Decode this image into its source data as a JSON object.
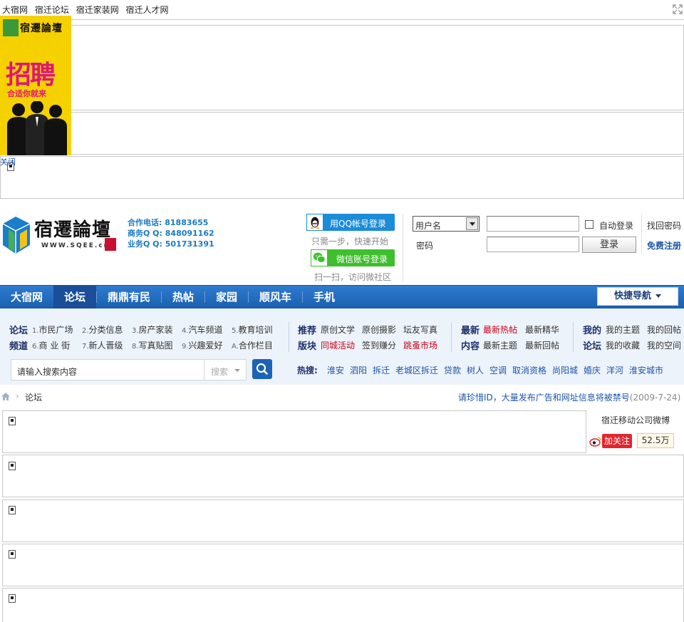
{
  "top_links": [
    "大宿网",
    "宿迁论坛",
    "宿迁家装网",
    "宿迁人才网"
  ],
  "ad": {
    "logo_text": "宿遷論壇",
    "headline": "招聘",
    "slogan": "合适你就来",
    "close_label": "关闭"
  },
  "header": {
    "logo_text": "宿遷論壇",
    "logo_url_text": "WWW.SQEE.cn",
    "contact": [
      "合作电话: 81883655",
      "商务Q Q: 848091162",
      "业务Q Q: 501731391"
    ],
    "qq_login": "用QQ帐号登录",
    "qq_tip": "只需一步，快速开始",
    "wechat_login": "微信账号登录",
    "wechat_tip": "扫一扫，访问微社区"
  },
  "login": {
    "username_select": "用户名",
    "password_label": "密码",
    "auto_login": "自动登录",
    "login_button": "登录",
    "forgot_password": "找回密码",
    "register": "免费注册"
  },
  "nav": {
    "items": [
      "大宿网",
      "论坛",
      "鼎鼎有民",
      "热帖",
      "家园",
      "顺风车",
      "手机"
    ],
    "active": "论坛",
    "quick_nav": "快捷导航"
  },
  "channels": {
    "group1": {
      "heads": [
        "论坛",
        "频道"
      ],
      "row1": [
        {
          "num": "1.",
          "label": "市民广场"
        },
        {
          "num": "2.",
          "label": "分类信息"
        },
        {
          "num": "3.",
          "label": "房产家装"
        },
        {
          "num": "4.",
          "label": "汽车频道"
        },
        {
          "num": "5.",
          "label": "教育培训"
        }
      ],
      "row2": [
        {
          "num": "6.",
          "label": "商 业 街"
        },
        {
          "num": "7.",
          "label": "新人晋级"
        },
        {
          "num": "8.",
          "label": "写真贴图"
        },
        {
          "num": "9.",
          "label": "兴趣爱好"
        },
        {
          "num": "A.",
          "label": "合作栏目"
        }
      ]
    },
    "group2": {
      "heads": [
        "推荐",
        "版块"
      ],
      "row1": [
        "原创文学",
        "原创摄影",
        "坛友写真"
      ],
      "row2": [
        "同城活动",
        "签到赚分",
        "跳蚤市场"
      ]
    },
    "group3": {
      "heads": [
        "最新",
        "内容"
      ],
      "row1": [
        "最新热帖",
        "最新精华"
      ],
      "row2": [
        "最新主题",
        "最新回帖"
      ]
    },
    "group4": {
      "heads": [
        "我的",
        "论坛"
      ],
      "row1": [
        "我的主题",
        "我的回帖"
      ],
      "row2": [
        "我的收藏",
        "我的空间"
      ]
    }
  },
  "search": {
    "placeholder": "请输入搜索内容",
    "type": "搜索"
  },
  "hot_search": {
    "label": "热搜:",
    "items": [
      "淮安",
      "泗阳",
      "拆迁",
      "老城区拆迁",
      "贷款",
      "树人",
      "空调",
      "取消资格",
      "尚阳城",
      "婚庆",
      "洋河",
      "淮安城市"
    ]
  },
  "breadcrumb": {
    "current": "论坛",
    "notice": "请珍惜ID，大量发布广告和网址信息将被禁号",
    "notice_date": "(2009-7-24)"
  },
  "weibo": {
    "name": "宿迁移动公司微博",
    "follow": "加关注",
    "fans": "52.5万"
  },
  "colors": {
    "nav_blue": "#1a5fae",
    "link_blue": "#1c55a8",
    "red": "#c8001a",
    "qq_blue": "#1a8cd8",
    "wechat_green": "#3fbf2e"
  }
}
